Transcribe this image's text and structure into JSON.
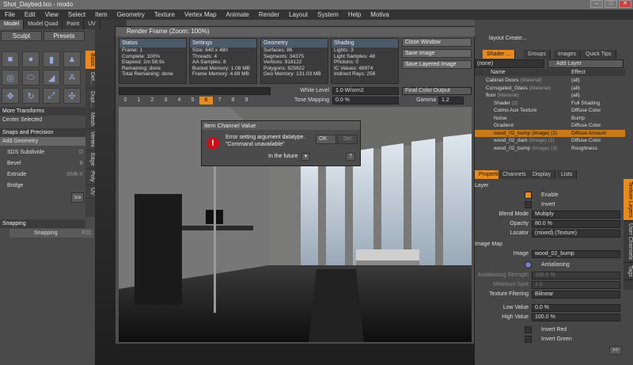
{
  "window": {
    "title": "Shot_Daybed.lxo - modo",
    "min": "–",
    "max": "□",
    "close": "✕"
  },
  "menu": [
    "File",
    "Edit",
    "View",
    "Select",
    "Item",
    "Geometry",
    "Texture",
    "Vertex Map",
    "Animate",
    "Render",
    "Layout",
    "System",
    "Help",
    "Motiva"
  ],
  "layout_tabs": [
    "Model",
    "Model Quad",
    "Paint",
    "UV"
  ],
  "left": {
    "sculpt": "Sculpt",
    "presets": "Presets",
    "more_transforms": "More Transforms",
    "center_selected": "Center Selected",
    "snaps_precision": "Snaps and Precision",
    "add_geometry": "Add Geometry",
    "tools": [
      {
        "label": "SDS Subdivide",
        "shortcut": "D"
      },
      {
        "label": "Bevel",
        "shortcut": "B"
      },
      {
        "label": "Extrude",
        "shortcut": "Shift-X"
      },
      {
        "label": "Bridge",
        "shortcut": ""
      }
    ],
    "snapping_header": "Snapping",
    "snapping_button": "Snapping",
    "snapping_shortcut": "F11",
    "vtabs": [
      "Basic",
      "Def...",
      "Dupl...",
      "Mesh",
      "Vertex",
      "Edge",
      "Poly",
      "UV"
    ],
    "more": ">>"
  },
  "render": {
    "title": "Render Frame (Zoom: 100%)",
    "status": {
      "header": "Status",
      "lines": [
        "Frame: 1",
        "Complete: 100%",
        "Elapsed: 2m 58.9s",
        "Remaining: done",
        "Total Remaining: done"
      ]
    },
    "settings": {
      "header": "Settings",
      "lines": [
        "Size: 640 x 480",
        "Threads: 4",
        "AA Samples: 8",
        "Bucket Memory: 1.08 MB",
        "Frame Memory: 4.69 MB"
      ]
    },
    "geometry": {
      "header": "Geometry",
      "lines": [
        "Surfaces: 86",
        "Segments: 34375",
        "Vertices: 918122",
        "Polygons: 825622",
        "Geo Memory: 131.03 MB"
      ]
    },
    "shading": {
      "header": "Shading",
      "lines": [
        "Lights: 3",
        "Light Samples: 48",
        "Photons: 0",
        "IC Values: 48974",
        "Indirect Rays: 256"
      ]
    },
    "buttons": [
      "Close Window",
      "Save Image",
      "Save Layered Image"
    ],
    "white_level_label": "White Level",
    "white_level": "1.0 W/srm2",
    "tone_mapping_label": "Tone Mapping",
    "tone_mapping": "0.0 %",
    "output": "Final Color Output",
    "gamma_label": "Gamma",
    "gamma": "1.2",
    "frames": [
      "0",
      "1",
      "2",
      "3",
      "4",
      "5",
      "6",
      "7",
      "8",
      "9"
    ],
    "active_frame": "6"
  },
  "dialog": {
    "title": "Item Channel Value",
    "message1": "Error setting argument datatype.",
    "message2": "\"Command unavailable\"",
    "ok": "OK",
    "set": "Set",
    "future": "In the future",
    "help": "?"
  },
  "right": {
    "top_label": "layout Create...",
    "tabs": [
      "Shader ...",
      "Groups",
      "Images",
      "Quick Tips"
    ],
    "filter": "(none)",
    "add_layer": "Add Layer",
    "col_name": "Name",
    "col_effect": "Effect",
    "tree": [
      {
        "name": "Cabinet Doors",
        "type": "(Material)",
        "effect": "(all)",
        "sel": false
      },
      {
        "name": "Corrugated_Glass",
        "type": "(Material)",
        "effect": "(all)",
        "sel": false
      },
      {
        "name": "floor",
        "type": "(Material)",
        "effect": "(all)",
        "sel": false
      },
      {
        "name": "Shader",
        "type": "(2)",
        "effect": "Full Shading",
        "sel": false
      },
      {
        "name": "Colmo Aux Texture",
        "type": "",
        "effect": "Diffuse Color",
        "sel": false
      },
      {
        "name": "Noise",
        "type": "",
        "effect": "Bump",
        "sel": false
      },
      {
        "name": "Gradient",
        "type": "",
        "effect": "Diffuse Color",
        "sel": false
      },
      {
        "name": "wood_02_bump",
        "type": "(Image) (2)",
        "effect": "Diffuse Amount",
        "sel": true
      },
      {
        "name": "wood_02_dark",
        "type": "(Image) (2)",
        "effect": "Diffuse Color",
        "sel": false
      },
      {
        "name": "wood_02_bump",
        "type": "(Image) (3)",
        "effect": "Roughness",
        "sel": false
      }
    ],
    "prop_tabs": [
      "Properties",
      "Channels",
      "Display",
      "Lists"
    ],
    "props": {
      "layer": "Layer",
      "enable": "Enable",
      "invert": "Invert",
      "blend_label": "Blend Mode",
      "blend": "Multiply",
      "opacity_label": "Opacity",
      "opacity": "80.0 %",
      "locator_label": "Locator",
      "locator": "(mixed) (Texture)",
      "image_map": "Image Map",
      "image_label": "Image",
      "image": "wood_02_bump",
      "antialias": "Antialiasing",
      "aa_strength_label": "Antialiasing Strength",
      "aa_strength": "100.0 %",
      "min_spot_label": "Minimum Spot",
      "min_spot": "1.0",
      "filtering_label": "Texture Filtering",
      "filtering": "Bilinear",
      "low_label": "Low Value",
      "low": "0.0 %",
      "high_label": "High Value",
      "high": "100.0 %",
      "invert_red": "Invert Red",
      "invert_green": "Invert Green",
      "more": ">>"
    },
    "vtabs": [
      "Texture Layers",
      "User Channels",
      "Tags"
    ]
  }
}
